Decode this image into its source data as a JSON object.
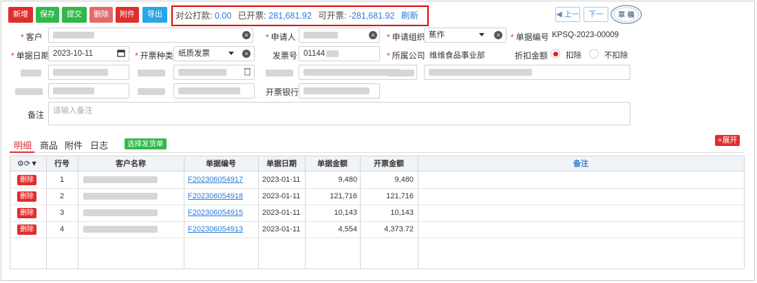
{
  "toolbar": {
    "new": "新增",
    "save": "保存",
    "submit": "提交",
    "delete": "删除",
    "attachment": "附件",
    "export": "导出"
  },
  "summary": {
    "public_payment_label": "对公打款:",
    "public_payment_value": "0.00",
    "invoiced_label": "已开票:",
    "invoiced_value": "281,681.92",
    "available_label": "可开票:",
    "available_value": "-281,681.92",
    "refresh": "刷新"
  },
  "nav": {
    "prev": "上一",
    "next": "下一"
  },
  "stamp": {
    "text": "草 稿"
  },
  "form": {
    "customer_label": "客户",
    "applicant_label": "申请人",
    "org_label": "申请组织",
    "org_value": "蕉作",
    "doc_no_label": "单据编号",
    "doc_no_value": "KPSQ-2023-00009",
    "date_label": "单据日期",
    "date_value": "2023-10-11",
    "invoice_type_label": "开票种类",
    "invoice_type_value": "纸质发票",
    "invoice_no_label": "发票号",
    "invoice_no_value": "01144",
    "company_label": "所属公司",
    "company_value": "维维食品事业部",
    "discount_label": "折扣金额",
    "discount_opt1": "扣除",
    "discount_opt2": "不扣除",
    "bank_label": "开票银行",
    "remark_label": "备注",
    "remark_placeholder": "请输入备注"
  },
  "tabs": {
    "detail": "明细",
    "goods": "商品",
    "attachment": "附件",
    "log": "日志"
  },
  "select_delivery": "选择发货单",
  "expand": "展开",
  "table": {
    "headers": {
      "rownum": "行号",
      "customer": "客户名称",
      "docno": "单据编号",
      "date": "单据日期",
      "amount": "单据金额",
      "invoice_amount": "开票金额",
      "remark": "备注"
    },
    "delete_label": "删除",
    "rows": [
      {
        "n": "1",
        "docno": "F202306054917",
        "date": "2023-01-11",
        "amount": "9,480",
        "invoice_amount": "9,480"
      },
      {
        "n": "2",
        "docno": "F202306054918",
        "date": "2023-01-11",
        "amount": "121,716",
        "invoice_amount": "121,716"
      },
      {
        "n": "3",
        "docno": "F202306054915",
        "date": "2023-01-11",
        "amount": "10,143",
        "invoice_amount": "10,143"
      },
      {
        "n": "4",
        "docno": "F202306054913",
        "date": "2023-01-11",
        "amount": "4,554",
        "invoice_amount": "4,373.72"
      }
    ]
  }
}
